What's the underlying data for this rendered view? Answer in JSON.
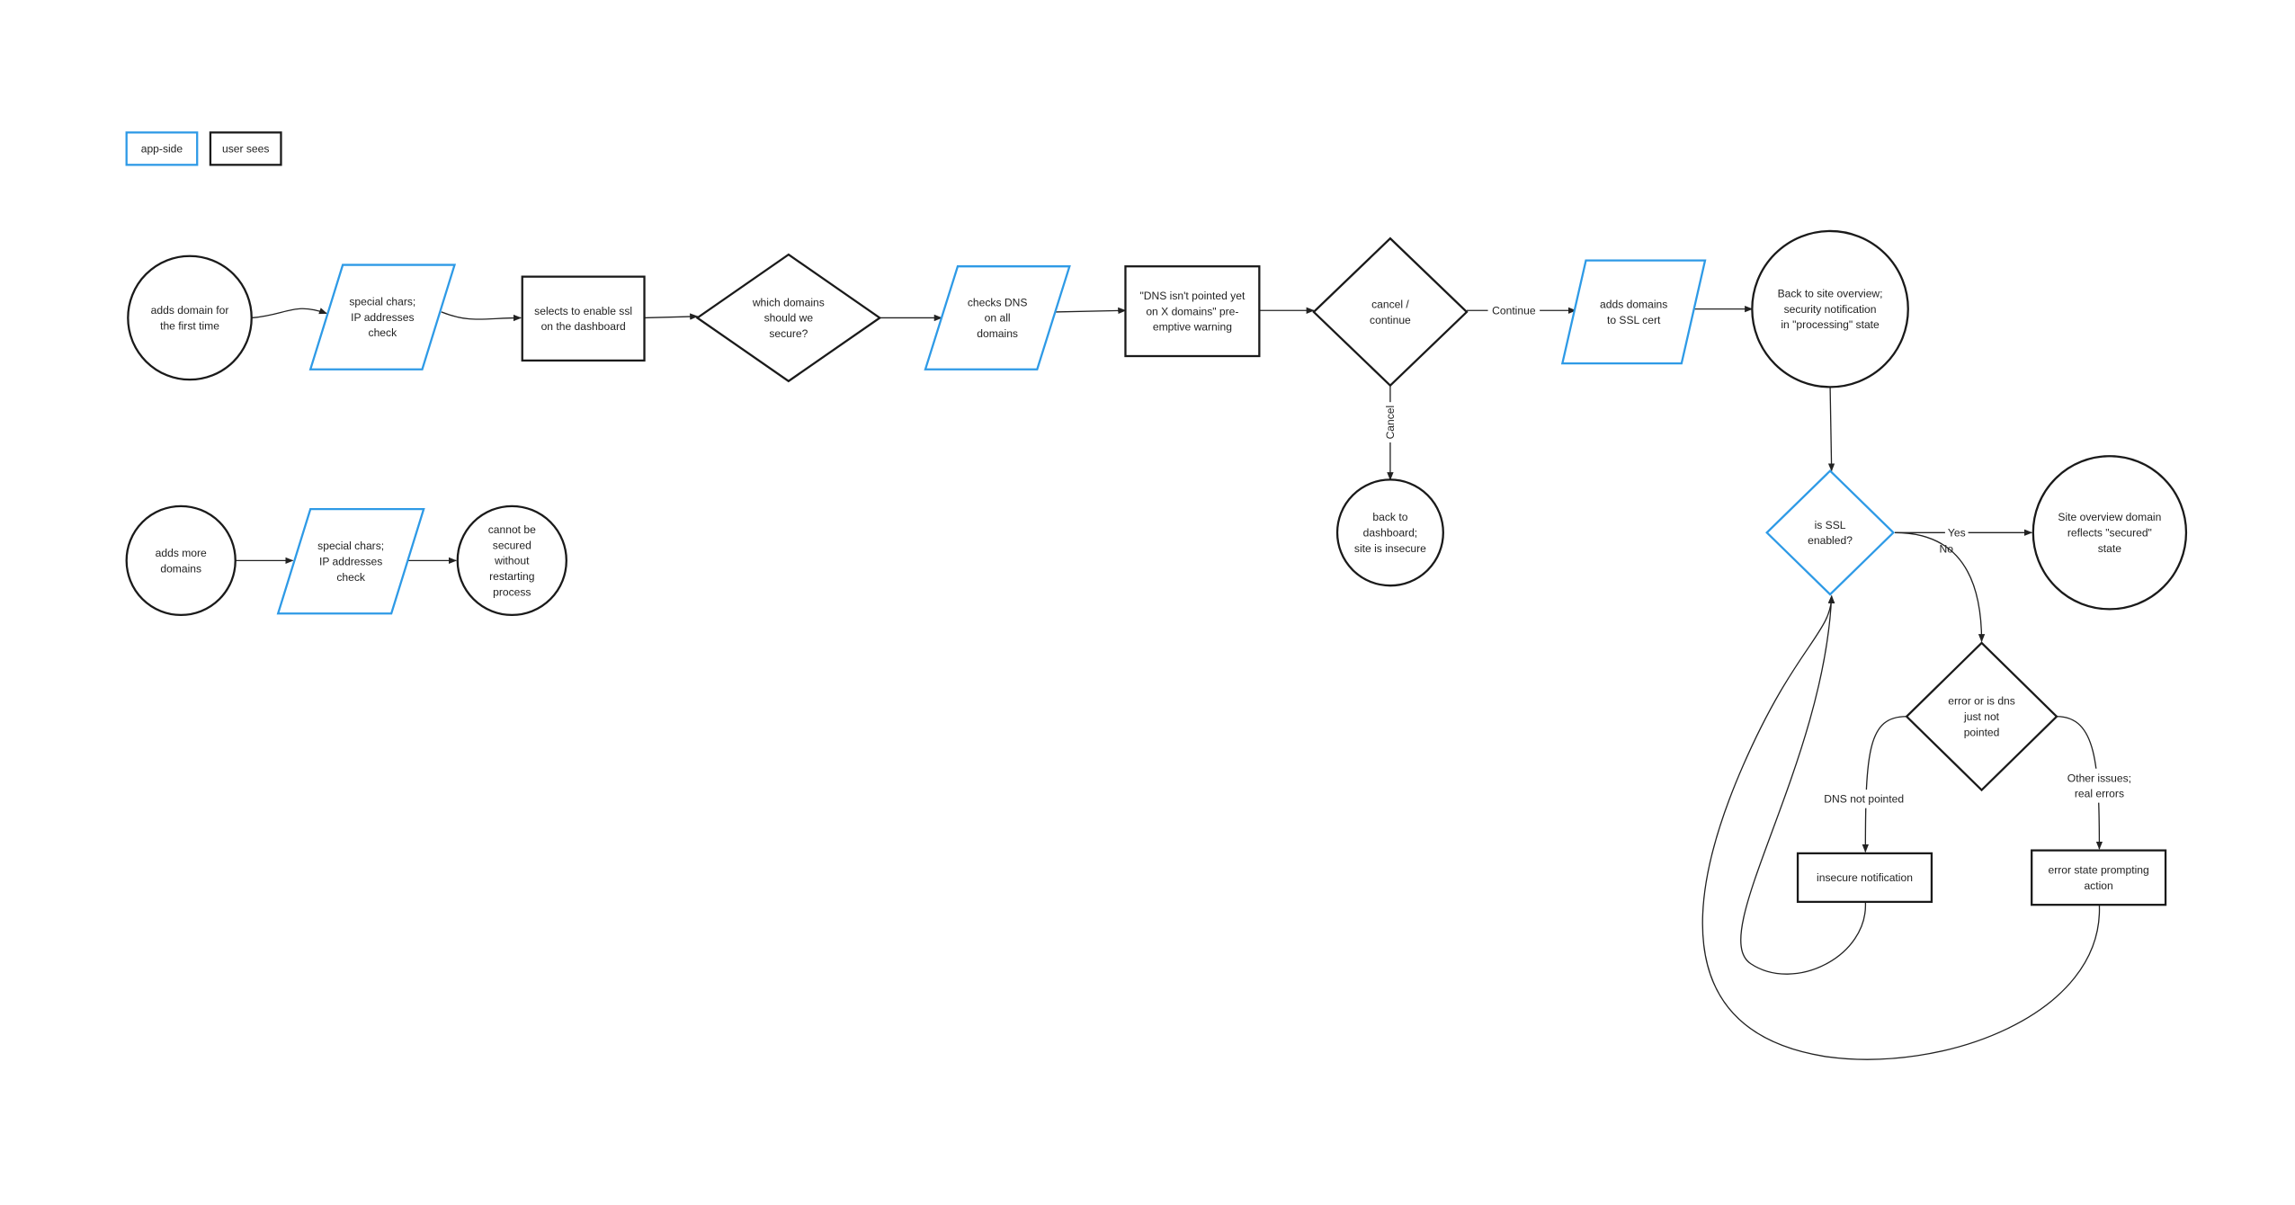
{
  "colors": {
    "app_side": "#2e9ae6",
    "user_sees": "#1a1a1a"
  },
  "legend": [
    {
      "id": "legend-app",
      "label": "app-side",
      "kind": "app-side"
    },
    {
      "id": "legend-user",
      "label": "user sees",
      "kind": "user-sees"
    }
  ],
  "nodes": {
    "c1": {
      "shape": "circle",
      "kind": "user-sees",
      "lines": [
        "adds domain for",
        "the first time"
      ]
    },
    "p1": {
      "shape": "parallelogram",
      "kind": "app-side",
      "lines": [
        "special chars;",
        "IP addresses",
        "check"
      ]
    },
    "r1": {
      "shape": "rectangle",
      "kind": "user-sees",
      "lines": [
        "selects to enable ssl",
        "on the dashboard"
      ]
    },
    "d1": {
      "shape": "diamond",
      "kind": "user-sees",
      "lines": [
        "which domains",
        "should we",
        "secure?"
      ]
    },
    "p2": {
      "shape": "parallelogram",
      "kind": "app-side",
      "lines": [
        "checks DNS",
        "on all",
        "domains"
      ]
    },
    "r2": {
      "shape": "rectangle",
      "kind": "user-sees",
      "lines": [
        "\"DNS isn't pointed yet",
        "on X domains\" pre-",
        "emptive warning"
      ]
    },
    "d2": {
      "shape": "diamond",
      "kind": "user-sees",
      "lines": [
        "cancel /",
        "continue"
      ]
    },
    "p3": {
      "shape": "parallelogram",
      "kind": "app-side",
      "lines": [
        "adds domains",
        "to SSL cert"
      ]
    },
    "c2": {
      "shape": "circle",
      "kind": "user-sees",
      "lines": [
        "Back to site overview;",
        "security notification",
        "in \"processing\" state"
      ]
    },
    "c3": {
      "shape": "circle",
      "kind": "user-sees",
      "lines": [
        "back to",
        "dashboard;",
        "site is insecure"
      ]
    },
    "d3": {
      "shape": "diamond",
      "kind": "app-side",
      "lines": [
        "is SSL",
        "enabled?"
      ]
    },
    "c4": {
      "shape": "circle",
      "kind": "user-sees",
      "lines": [
        "Site overview domain",
        "reflects \"secured\"",
        "state"
      ]
    },
    "d4": {
      "shape": "diamond",
      "kind": "user-sees",
      "lines": [
        "error or is dns",
        "just not",
        "pointed"
      ]
    },
    "r3": {
      "shape": "rectangle",
      "kind": "user-sees",
      "lines": [
        "insecure notification"
      ]
    },
    "r4": {
      "shape": "rectangle",
      "kind": "user-sees",
      "lines": [
        "error state prompting",
        "action"
      ]
    },
    "c5": {
      "shape": "circle",
      "kind": "user-sees",
      "lines": [
        "adds more",
        "domains"
      ]
    },
    "p4": {
      "shape": "parallelogram",
      "kind": "app-side",
      "lines": [
        "special chars;",
        "IP addresses",
        "check"
      ]
    },
    "c6": {
      "shape": "circle",
      "kind": "user-sees",
      "lines": [
        "cannot be",
        "secured",
        "without",
        "restarting",
        "process"
      ]
    }
  },
  "edges": [
    {
      "from": "c1",
      "to": "p1"
    },
    {
      "from": "p1",
      "to": "r1"
    },
    {
      "from": "r1",
      "to": "d1"
    },
    {
      "from": "d1",
      "to": "p2"
    },
    {
      "from": "p2",
      "to": "r2"
    },
    {
      "from": "r2",
      "to": "d2"
    },
    {
      "from": "d2",
      "to": "p3",
      "label": [
        "Continue"
      ]
    },
    {
      "from": "d2",
      "to": "c3",
      "label": [
        "Cancel"
      ]
    },
    {
      "from": "p3",
      "to": "c2"
    },
    {
      "from": "c2",
      "to": "d3"
    },
    {
      "from": "d3",
      "to": "c4",
      "label": [
        "Yes"
      ]
    },
    {
      "from": "d3",
      "to": "d4",
      "label": [
        "No"
      ]
    },
    {
      "from": "d4",
      "to": "r3",
      "label": [
        "DNS not pointed"
      ]
    },
    {
      "from": "d4",
      "to": "r4",
      "label": [
        "Other issues;",
        "real errors"
      ]
    },
    {
      "from": "r3",
      "to": "d3"
    },
    {
      "from": "r4",
      "to": "d3"
    },
    {
      "from": "c5",
      "to": "p4"
    },
    {
      "from": "p4",
      "to": "c6"
    }
  ]
}
